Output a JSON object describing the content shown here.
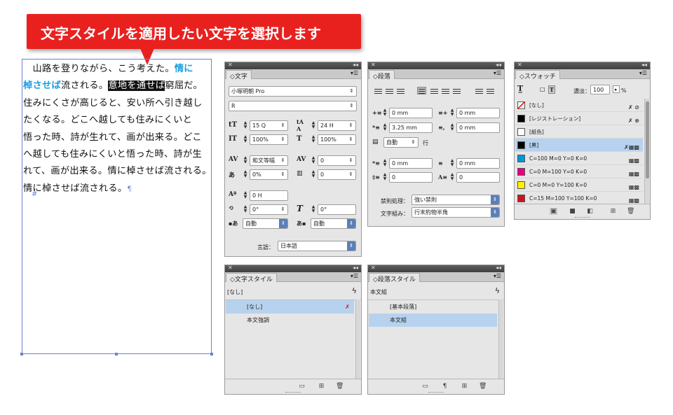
{
  "callout": {
    "text": "文字スタイルを適用したい文字を選択します"
  },
  "document": {
    "line1_a": "山路を登りながら、こう考えた。",
    "line1_b": "情に",
    "line2_a": "棹させば",
    "line2_b": "流される。",
    "line2_sel": "意地を通せば",
    "line2_c": "窮屈だ。",
    "line3": "住みにくさが高じると、安い所へ引き越し",
    "line4": "たくなる。どこへ越しても住みにくいと",
    "line5": "悟った時、詩が生れて、画が出来る。どこ",
    "line6": "へ越しても住みにくいと悟った時、詩が生",
    "line7": "れて、画が出来る。情に棹させば流される。",
    "line8": "情に棹させば流される。",
    "pilcrow": "¶",
    "hash": "#"
  },
  "char_panel": {
    "tab": "文字",
    "font_family": "小塚明朝 Pro",
    "font_style": "R",
    "size": "15 Q",
    "leading": "24 H",
    "vscale": "100%",
    "hscale": "100%",
    "kerning": "和文等幅",
    "tracking": "0",
    "tsume": "0%",
    "aki": "0",
    "baseline": "0 H",
    "rotate": "0°",
    "skew": "0°",
    "aki_before": "自動",
    "aki_after": "自動",
    "language_label": "言語：",
    "language": "日本語"
  },
  "para_panel": {
    "tab": "段落",
    "left_indent": "0 mm",
    "right_indent": "0 mm",
    "first_indent": "3.25 mm",
    "last_indent": "0 mm",
    "drop_lines": "自動",
    "drop_unit": "行",
    "space_before": "0 mm",
    "space_after": "0 mm",
    "drop_a": "0",
    "drop_b": "0",
    "kinsoku_label": "禁則処理：",
    "kinsoku": "強い禁則",
    "mojikumi_label": "文字組み：",
    "mojikumi": "行末約物半角"
  },
  "swatch_panel": {
    "tab": "スウォッチ",
    "tint_label": "濃淡：",
    "tint": "100",
    "tint_unit": "%",
    "items": [
      {
        "name": "[なし]",
        "color": "none"
      },
      {
        "name": "[レジストレーション]",
        "color": "#000000"
      },
      {
        "name": "[紙色]",
        "color": "#ffffff"
      },
      {
        "name": "[黒]",
        "color": "#000000"
      },
      {
        "name": "C=100 M=0 Y=0 K=0",
        "color": "#0097d8"
      },
      {
        "name": "C=0 M=100 Y=0 K=0",
        "color": "#e4007f"
      },
      {
        "name": "C=0 M=0 Y=100 K=0",
        "color": "#fff100"
      },
      {
        "name": "C=15 M=100 Y=100 K=0",
        "color": "#c8161d"
      }
    ]
  },
  "char_style_panel": {
    "tab": "文字スタイル",
    "current": "[なし]",
    "items": [
      "[なし]",
      "本文強調"
    ]
  },
  "para_style_panel": {
    "tab": "段落スタイル",
    "current": "本文組",
    "items": [
      "[基本段落]",
      "本文組"
    ]
  },
  "colors": {
    "callout": "#e8211f",
    "highlight_text": "#1a9ee0",
    "list_selection": "#b7d2ee"
  }
}
